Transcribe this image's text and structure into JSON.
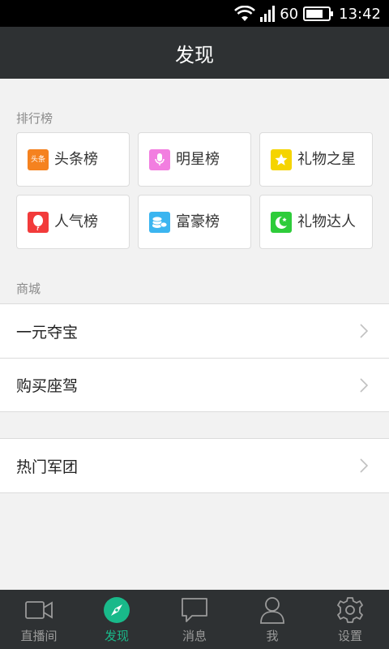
{
  "status_bar": {
    "signal_text": "60",
    "time": "13:42"
  },
  "header": {
    "title": "发现"
  },
  "ranking": {
    "section_label": "排行榜",
    "items": [
      {
        "label": "头条榜",
        "icon": "headline-icon",
        "icon_text": "头条",
        "color": "#f5821f"
      },
      {
        "label": "明星榜",
        "icon": "microphone-icon",
        "color": "#f27ee0"
      },
      {
        "label": "礼物之星",
        "icon": "star-icon",
        "color": "#f5d400"
      },
      {
        "label": "人气榜",
        "icon": "balloon-icon",
        "color": "#f23b3b"
      },
      {
        "label": "富豪榜",
        "icon": "coins-icon",
        "color": "#3bb5f0"
      },
      {
        "label": "礼物达人",
        "icon": "moon-star-icon",
        "color": "#2ecc3a"
      }
    ]
  },
  "mall": {
    "section_label": "商城",
    "items": [
      {
        "label": "一元夺宝"
      },
      {
        "label": "购买座驾"
      }
    ]
  },
  "groups": {
    "items": [
      {
        "label": "热门军团"
      }
    ]
  },
  "tabbar": {
    "tabs": [
      {
        "label": "直播间",
        "icon": "video-camera-icon"
      },
      {
        "label": "发现",
        "icon": "compass-icon",
        "active": true
      },
      {
        "label": "消息",
        "icon": "chat-bubble-icon"
      },
      {
        "label": "我",
        "icon": "person-icon"
      },
      {
        "label": "设置",
        "icon": "gear-icon"
      }
    ],
    "active_color": "#19b98a"
  }
}
